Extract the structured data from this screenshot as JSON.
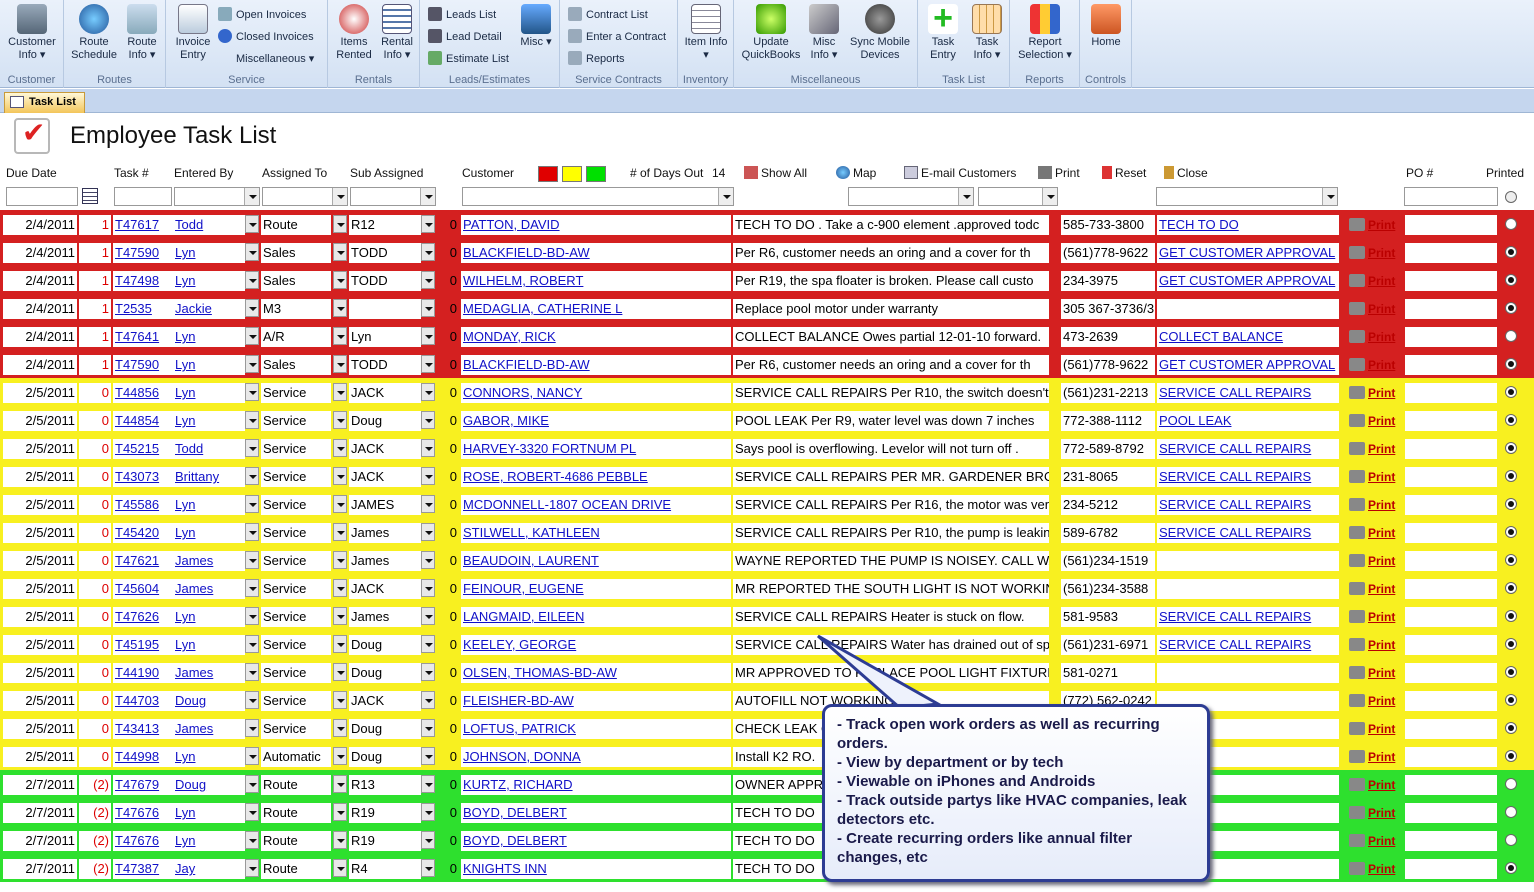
{
  "ribbon": {
    "groups": [
      {
        "label": "Customer"
      },
      {
        "label": "Routes"
      },
      {
        "label": "Service"
      },
      {
        "label": "Rentals"
      },
      {
        "label": "Leads/Estimates"
      },
      {
        "label": "Service Contracts"
      },
      {
        "label": "Inventory"
      },
      {
        "label": "Miscellaneous"
      },
      {
        "label": "Task List"
      },
      {
        "label": "Reports"
      },
      {
        "label": "Controls"
      }
    ],
    "buttons": {
      "customer_info": "Customer Info ▾",
      "route_schedule": "Route Schedule",
      "route_info": "Route Info ▾",
      "invoice_entry": "Invoice Entry",
      "open_invoices": "Open Invoices",
      "closed_invoices": "Closed Invoices",
      "miscellaneous": "Miscellaneous ▾",
      "items_rented": "Items Rented",
      "rental_info": "Rental Info ▾",
      "leads_list": "Leads List",
      "lead_detail": "Lead Detail",
      "estimate_list": "Estimate List",
      "misc": "Misc ▾",
      "contract_list": "Contract List",
      "enter_contract": "Enter a Contract",
      "reports": "Reports",
      "item_info": "Item Info ▾",
      "update_quickbooks": "Update QuickBooks",
      "misc_info": "Misc Info ▾",
      "sync_mobile": "Sync Mobile Devices",
      "task_entry": "Task Entry",
      "task_info": "Task Info ▾",
      "report_selection": "Report Selection ▾",
      "home": "Home"
    }
  },
  "tab": {
    "label": "Task List"
  },
  "form": {
    "title": "Employee Task List"
  },
  "headers": {
    "due_date": "Due Date",
    "task_no": "Task #",
    "entered_by": "Entered By",
    "assigned_to": "Assigned To",
    "sub_assigned": "Sub Assigned",
    "customer": "Customer",
    "days_out": "# of Days Out",
    "days_out_value": "14",
    "show_all": "Show All",
    "map": "Map",
    "email_customers": "E-mail Customers",
    "print": "Print",
    "reset": "Reset",
    "close": "Close",
    "po": "PO #",
    "printed": "Printed"
  },
  "swatches": {
    "red": "#e00000",
    "yellow": "#ffff00",
    "green": "#00e000"
  },
  "print_label": "Print",
  "rows": [
    {
      "color": "red",
      "date": "2/4/2011",
      "pri": "1",
      "task": "T47617",
      "by": "Todd",
      "assigned": "Route",
      "sub": "R12",
      "n": "0",
      "customer": "PATTON, DAVID",
      "desc": "TECH TO DO . Take a c-900 element .approved todc",
      "phone": "585-733-3800",
      "status": "TECH TO DO",
      "printed": false
    },
    {
      "color": "red",
      "date": "2/4/2011",
      "pri": "1",
      "task": "T47590",
      "by": "Lyn",
      "assigned": "Sales",
      "sub": "TODD",
      "n": "0",
      "customer": "BLACKFIELD-BD-AW",
      "desc": "Per R6, customer needs an oring and a cover for th",
      "phone": "(561)778-9622",
      "status": "GET CUSTOMER APPROVAL",
      "printed": true
    },
    {
      "color": "red",
      "date": "2/4/2011",
      "pri": "1",
      "task": "T47498",
      "by": "Lyn",
      "assigned": "Sales",
      "sub": "TODD",
      "n": "0",
      "customer": "WILHELM, ROBERT",
      "desc": "Per R19, the spa floater is broken.  Please call custo",
      "phone": "234-3975",
      "status": "GET CUSTOMER APPROVAL",
      "printed": true
    },
    {
      "color": "red",
      "date": "2/4/2011",
      "pri": "1",
      "task": "T2535",
      "by": "Jackie",
      "assigned": "M3",
      "sub": "",
      "n": "0",
      "customer": "MEDAGLIA, CATHERINE L",
      "desc": "Replace pool motor under warranty",
      "phone": "305 367-3736/3:",
      "status": "",
      "printed": true
    },
    {
      "color": "red",
      "date": "2/4/2011",
      "pri": "1",
      "task": "T47641",
      "by": "Lyn",
      "assigned": "A/R",
      "sub": "Lyn",
      "n": "0",
      "customer": "MONDAY, RICK",
      "desc": "COLLECT BALANCE  Owes partial 12-01-10 forward.",
      "phone": "473-2639",
      "status": "COLLECT BALANCE",
      "printed": false
    },
    {
      "color": "red",
      "date": "2/4/2011",
      "pri": "1",
      "task": "T47590",
      "by": "Lyn",
      "assigned": "Sales",
      "sub": "TODD",
      "n": "0",
      "customer": "BLACKFIELD-BD-AW",
      "desc": "Per R6, customer needs an oring and a cover for th",
      "phone": "(561)778-9622",
      "status": "GET CUSTOMER APPROVAL",
      "printed": true
    },
    {
      "color": "yellow",
      "date": "2/5/2011",
      "pri": "0",
      "task": "T44856",
      "by": "Lyn",
      "assigned": "Service",
      "sub": "JACK",
      "n": "0",
      "customer": "CONNORS, NANCY",
      "desc": "SERVICE CALL REPAIRS  Per R10, the switch doesn't",
      "phone": "(561)231-2213",
      "status": "SERVICE CALL REPAIRS",
      "printed": true
    },
    {
      "color": "yellow",
      "date": "2/5/2011",
      "pri": "0",
      "task": "T44854",
      "by": "Lyn",
      "assigned": "Service",
      "sub": "Doug",
      "n": "0",
      "customer": "GABOR, MIKE",
      "desc": "POOL LEAK  Per R9, water level was down 7 inches",
      "phone": "772-388-1112",
      "status": "POOL LEAK",
      "printed": true
    },
    {
      "color": "yellow",
      "date": "2/5/2011",
      "pri": "0",
      "task": "T45215",
      "by": "Todd",
      "assigned": "Service",
      "sub": "JACK",
      "n": "0",
      "customer": "HARVEY-3320 FORTNUM PL",
      "desc": "Says pool is overflowing. Levelor will not turn off .",
      "phone": "772-589-8792",
      "status": "SERVICE CALL REPAIRS",
      "printed": true
    },
    {
      "color": "yellow",
      "date": "2/5/2011",
      "pri": "0",
      "task": "T43073",
      "by": "Brittany",
      "assigned": "Service",
      "sub": "JACK",
      "n": "0",
      "customer": "ROSE, ROBERT-4686 PEBBLE",
      "desc": "SERVICE CALL REPAIRS PER MR. GARDENER BROKE /",
      "phone": "231-8065",
      "status": "SERVICE CALL REPAIRS",
      "printed": true
    },
    {
      "color": "yellow",
      "date": "2/5/2011",
      "pri": "0",
      "task": "T45586",
      "by": "Lyn",
      "assigned": "Service",
      "sub": "JAMES",
      "n": "0",
      "customer": "MCDONNELL-1807 OCEAN DRIVE",
      "desc": "SERVICE CALL REPAIRS  Per R16, the motor was ver",
      "phone": "234-5212",
      "status": "SERVICE CALL REPAIRS",
      "printed": true
    },
    {
      "color": "yellow",
      "date": "2/5/2011",
      "pri": "0",
      "task": "T45420",
      "by": "Lyn",
      "assigned": "Service",
      "sub": "James",
      "n": "0",
      "customer": "STILWELL, KATHLEEN",
      "desc": "SERVICE CALL REPAIRS  Per R10, the pump is leakin",
      "phone": "589-6782",
      "status": "SERVICE CALL REPAIRS",
      "printed": true
    },
    {
      "color": "yellow",
      "date": "2/5/2011",
      "pri": "0",
      "task": "T47621",
      "by": "James",
      "assigned": "Service",
      "sub": "James",
      "n": "0",
      "customer": "BEAUDOIN, LAURENT",
      "desc": "WAYNE REPORTED THE PUMP IS NOISEY. CALL WAY",
      "phone": "(561)234-1519",
      "status": "",
      "printed": true
    },
    {
      "color": "yellow",
      "date": "2/5/2011",
      "pri": "0",
      "task": "T45604",
      "by": "James",
      "assigned": "Service",
      "sub": "JACK",
      "n": "0",
      "customer": "FEINOUR, EUGENE",
      "desc": "MR REPORTED THE SOUTH LIGHT IS NOT WORKING",
      "phone": "(561)234-3588",
      "status": "",
      "printed": true
    },
    {
      "color": "yellow",
      "date": "2/5/2011",
      "pri": "0",
      "task": "T47626",
      "by": "Lyn",
      "assigned": "Service",
      "sub": "James",
      "n": "0",
      "customer": "LANGMAID, EILEEN",
      "desc": "SERVICE CALL REPAIRS  Heater is stuck on flow.",
      "phone": "581-9583",
      "status": "SERVICE CALL REPAIRS",
      "printed": true
    },
    {
      "color": "yellow",
      "date": "2/5/2011",
      "pri": "0",
      "task": "T45195",
      "by": "Lyn",
      "assigned": "Service",
      "sub": "Doug",
      "n": "0",
      "customer": "KEELEY, GEORGE",
      "desc": "SERVICE CALL REPAIRS  Water has drained out of sp",
      "phone": "(561)231-6971",
      "status": "SERVICE CALL REPAIRS",
      "printed": true
    },
    {
      "color": "yellow",
      "date": "2/5/2011",
      "pri": "0",
      "task": "T44190",
      "by": "James",
      "assigned": "Service",
      "sub": "Doug",
      "n": "0",
      "customer": "OLSEN, THOMAS-BD-AW",
      "desc": "MR APPROVED TO REPLACE POOL LIGHT FIXTURE PI",
      "phone": "581-0271",
      "status": "",
      "printed": true
    },
    {
      "color": "yellow",
      "date": "2/5/2011",
      "pri": "0",
      "task": "T44703",
      "by": "Doug",
      "assigned": "Service",
      "sub": "JACK",
      "n": "0",
      "customer": "FLEISHER-BD-AW",
      "desc": "AUTOFILL NOT WORKING",
      "phone": "(772) 562-0242",
      "status": "",
      "printed": true
    },
    {
      "color": "yellow",
      "date": "2/5/2011",
      "pri": "0",
      "task": "T43413",
      "by": "James",
      "assigned": "Service",
      "sub": "Doug",
      "n": "0",
      "customer": "LOFTUS, PATRICK",
      "desc": "CHECK LEAK ON",
      "phone": "",
      "status": "",
      "printed": true
    },
    {
      "color": "yellow",
      "date": "2/5/2011",
      "pri": "0",
      "task": "T44998",
      "by": "Lyn",
      "assigned": "Automatic",
      "sub": "Doug",
      "n": "0",
      "customer": "JOHNSON, DONNA",
      "desc": "Install K2 RO.",
      "phone": "",
      "status": "ATION",
      "printed": true
    },
    {
      "color": "green",
      "date": "2/7/2011",
      "pri": "(2)",
      "task": "T47679",
      "by": "Doug",
      "assigned": "Route",
      "sub": "R13",
      "n": "0",
      "customer": "KURTZ, RICHARD",
      "desc": "OWNER APPRO",
      "phone": "",
      "status": "",
      "printed": false
    },
    {
      "color": "green",
      "date": "2/7/2011",
      "pri": "(2)",
      "task": "T47676",
      "by": "Lyn",
      "assigned": "Route",
      "sub": "R19",
      "n": "0",
      "customer": "BOYD, DELBERT",
      "desc": "TECH TO DO",
      "phone": "",
      "status": "DO",
      "printed": false
    },
    {
      "color": "green",
      "date": "2/7/2011",
      "pri": "(2)",
      "task": "T47676",
      "by": "Lyn",
      "assigned": "Route",
      "sub": "R19",
      "n": "0",
      "customer": "BOYD, DELBERT",
      "desc": "TECH TO DO",
      "phone": "",
      "status": "DO",
      "printed": false
    },
    {
      "color": "green",
      "date": "2/7/2011",
      "pri": "(2)",
      "task": "T47387",
      "by": "Jay",
      "assigned": "Route",
      "sub": "R4",
      "n": "0",
      "customer": "KNIGHTS INN",
      "desc": "TECH TO DO",
      "phone": "",
      "status": "LE",
      "printed": true
    }
  ],
  "callout": {
    "lines": [
      "- Track open work orders as well as recurring orders.",
      "- View by department or by tech",
      "- Viewable on iPhones and Androids",
      "- Track outside partys like HVAC companies, leak detectors etc.",
      "- Create recurring orders like annual filter changes, etc"
    ]
  }
}
